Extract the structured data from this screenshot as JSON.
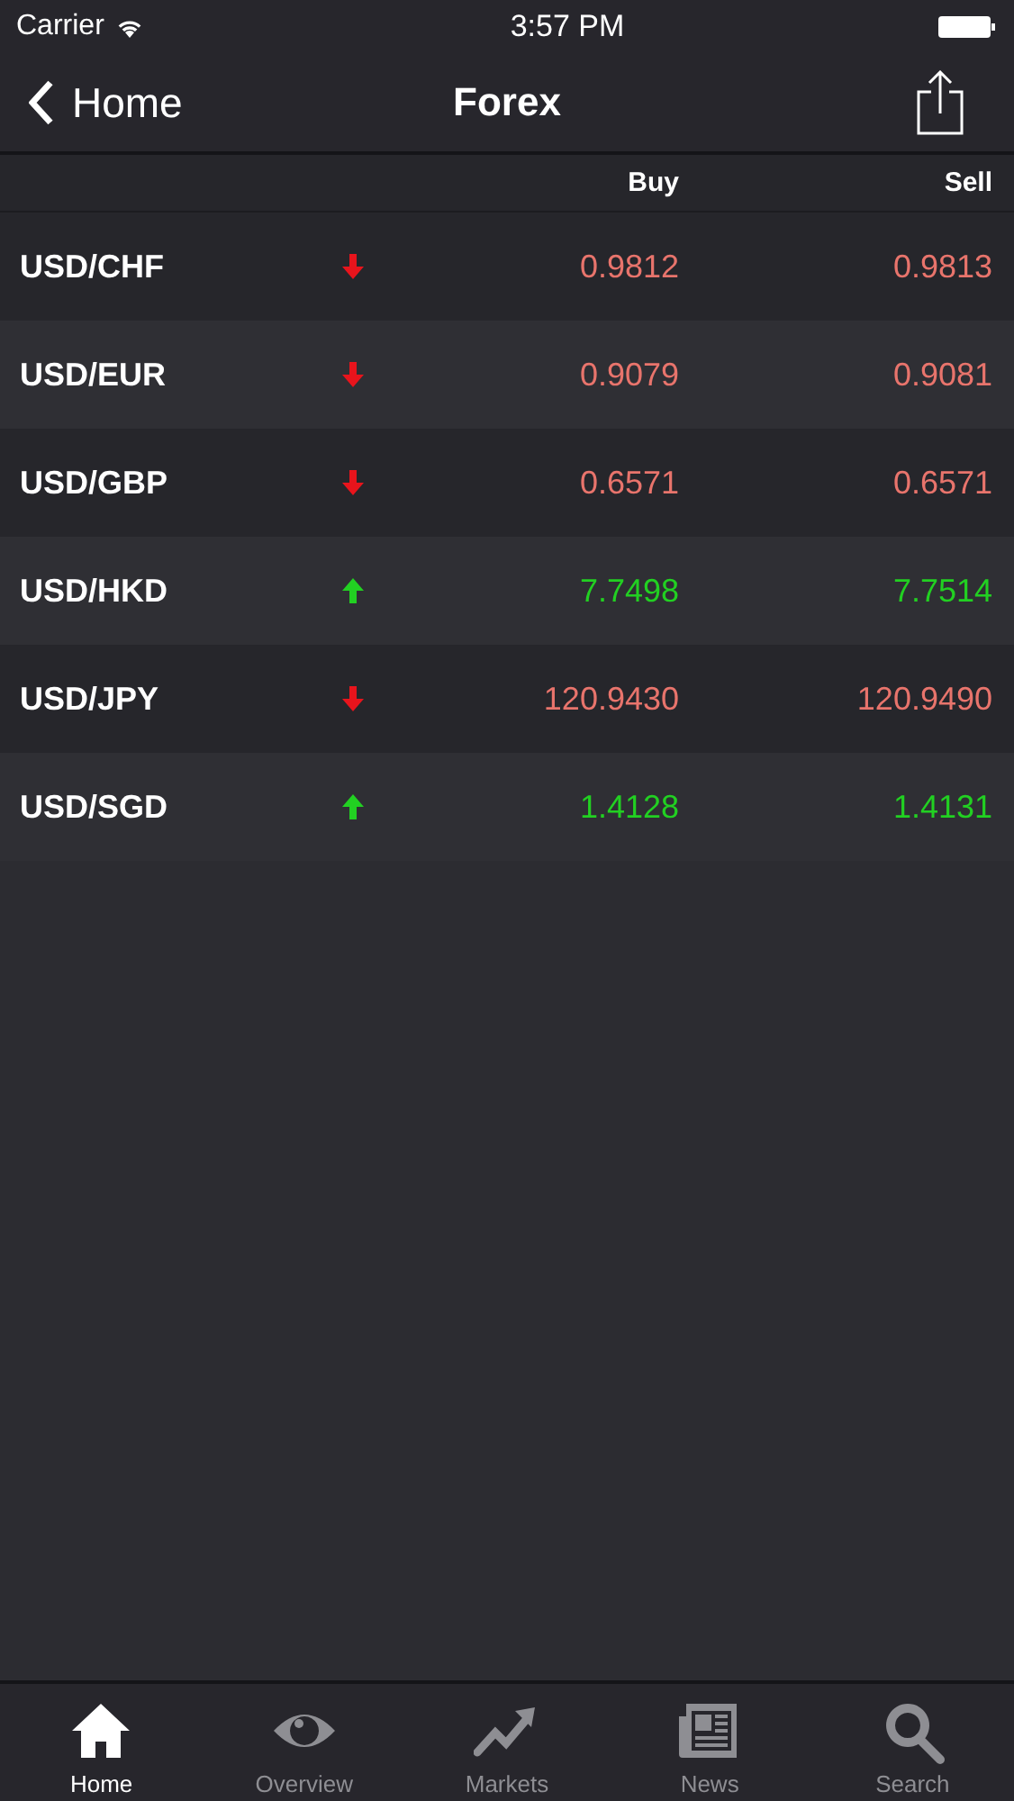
{
  "status_bar": {
    "carrier": "Carrier",
    "time": "3:57 PM"
  },
  "nav": {
    "back": "Home",
    "title": "Forex"
  },
  "table": {
    "columns": [
      "Buy",
      "Sell"
    ],
    "rows": [
      {
        "pair": "USD/CHF",
        "kind": "down",
        "buy": "0.9812",
        "sell": "0.9813"
      },
      {
        "pair": "USD/EUR",
        "kind": "down",
        "buy": "0.9079",
        "sell": "0.9081"
      },
      {
        "pair": "USD/GBP",
        "kind": "down",
        "buy": "0.6571",
        "sell": "0.6571"
      },
      {
        "pair": "USD/HKD",
        "kind": "up",
        "buy": "7.7498",
        "sell": "7.7514"
      },
      {
        "pair": "USD/JPY",
        "kind": "down",
        "buy": "120.9430",
        "sell": "120.9490"
      },
      {
        "pair": "USD/SGD",
        "kind": "up",
        "buy": "1.4128",
        "sell": "1.4131"
      }
    ]
  },
  "tab_bar": [
    {
      "label": "Home",
      "selected": true
    },
    {
      "label": "Overview",
      "selected": false
    },
    {
      "label": "Markets",
      "selected": false
    },
    {
      "label": "News",
      "selected": false
    },
    {
      "label": "Search",
      "selected": false
    }
  ]
}
